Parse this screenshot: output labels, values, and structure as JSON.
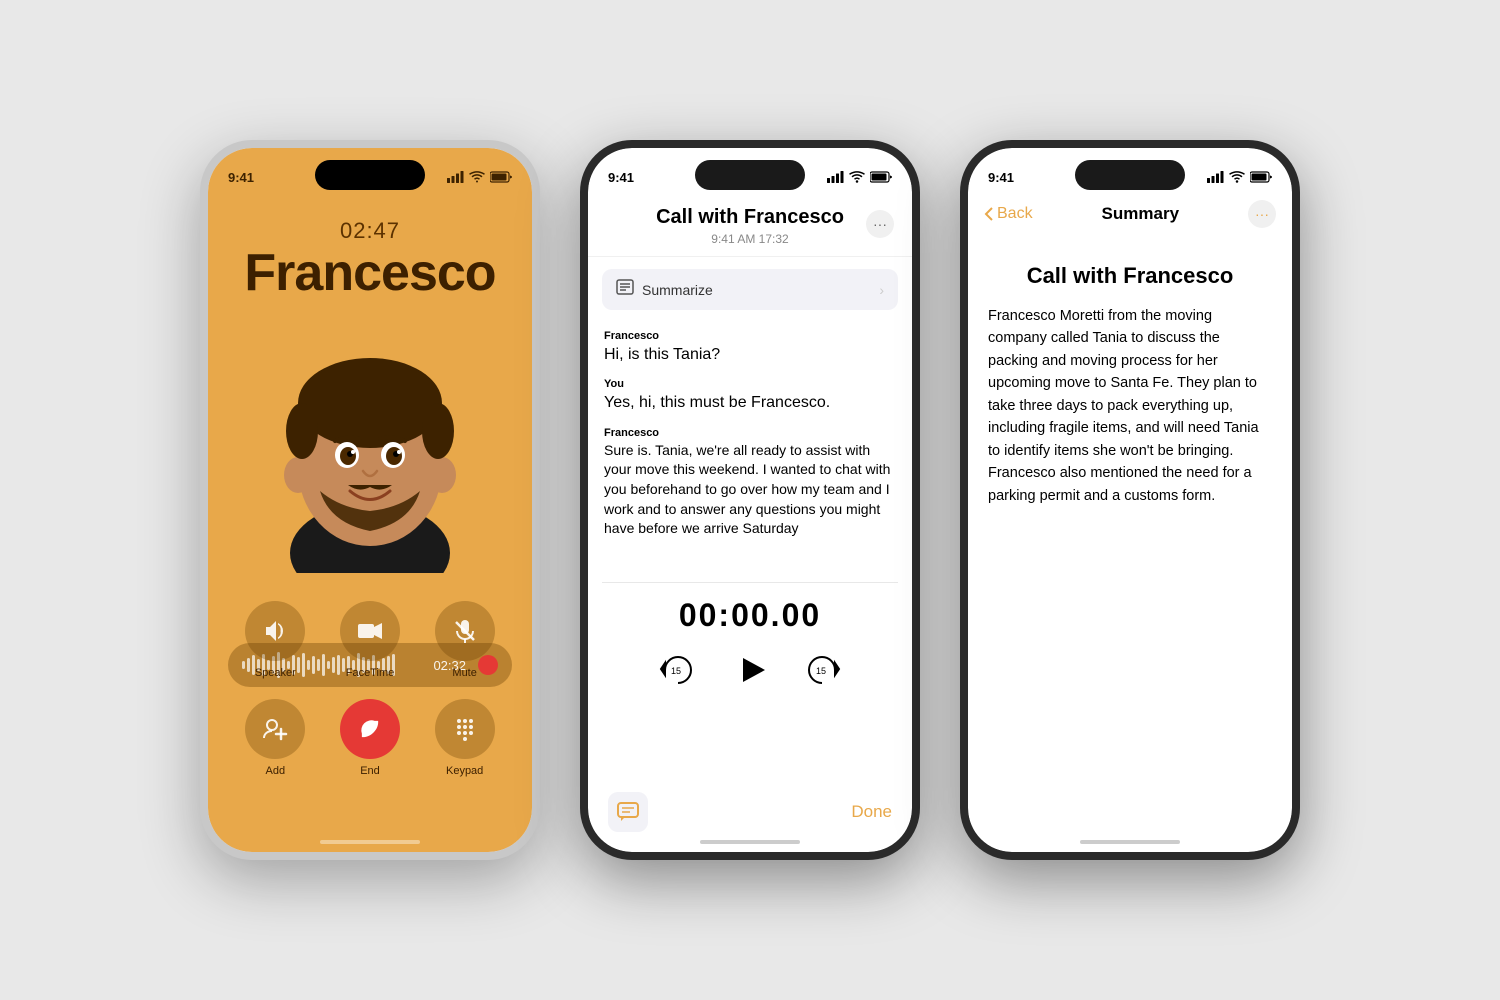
{
  "bg_color": "#e8e8e8",
  "phone1": {
    "status_time": "9:41",
    "call_timer": "02:47",
    "call_name": "Francesco",
    "rec_timer": "02:32",
    "buttons": [
      {
        "icon": "🔊",
        "label": "Speaker"
      },
      {
        "icon": "📹",
        "label": "FaceTime"
      },
      {
        "icon": "🎙",
        "label": "Mute"
      },
      {
        "icon": "👤",
        "label": "Add"
      },
      {
        "icon": "📞",
        "label": "End",
        "type": "end"
      },
      {
        "icon": "⌨️",
        "label": "Keypad"
      }
    ]
  },
  "phone2": {
    "status_time": "9:41",
    "title": "Call with Francesco",
    "subtitle": "9:41 AM  17:32",
    "summarize_label": "Summarize",
    "messages": [
      {
        "speaker": "Francesco",
        "text": "Hi, is this Tania?",
        "bold": true
      },
      {
        "speaker": "You",
        "text": "Yes, hi, this must be Francesco.",
        "bold": true
      },
      {
        "speaker": "Francesco",
        "text": "Sure is. Tania, we're all ready to assist with your move this weekend. I wanted to chat with you beforehand to go over how my team and I work and to answer any questions you might have before we arrive Saturday",
        "bold": false
      }
    ],
    "playback_timer": "00:00.00",
    "done_label": "Done"
  },
  "phone3": {
    "status_time": "9:41",
    "back_label": "Back",
    "nav_title": "Summary",
    "summary_title": "Call with Francesco",
    "summary_body": "Francesco Moretti from the moving company called Tania to discuss the packing and moving process for her upcoming move to Santa Fe. They plan to take three days to pack everything up, including fragile items, and will need Tania to identify items she won't be bringing. Francesco also mentioned the need for a parking permit and a customs form."
  }
}
